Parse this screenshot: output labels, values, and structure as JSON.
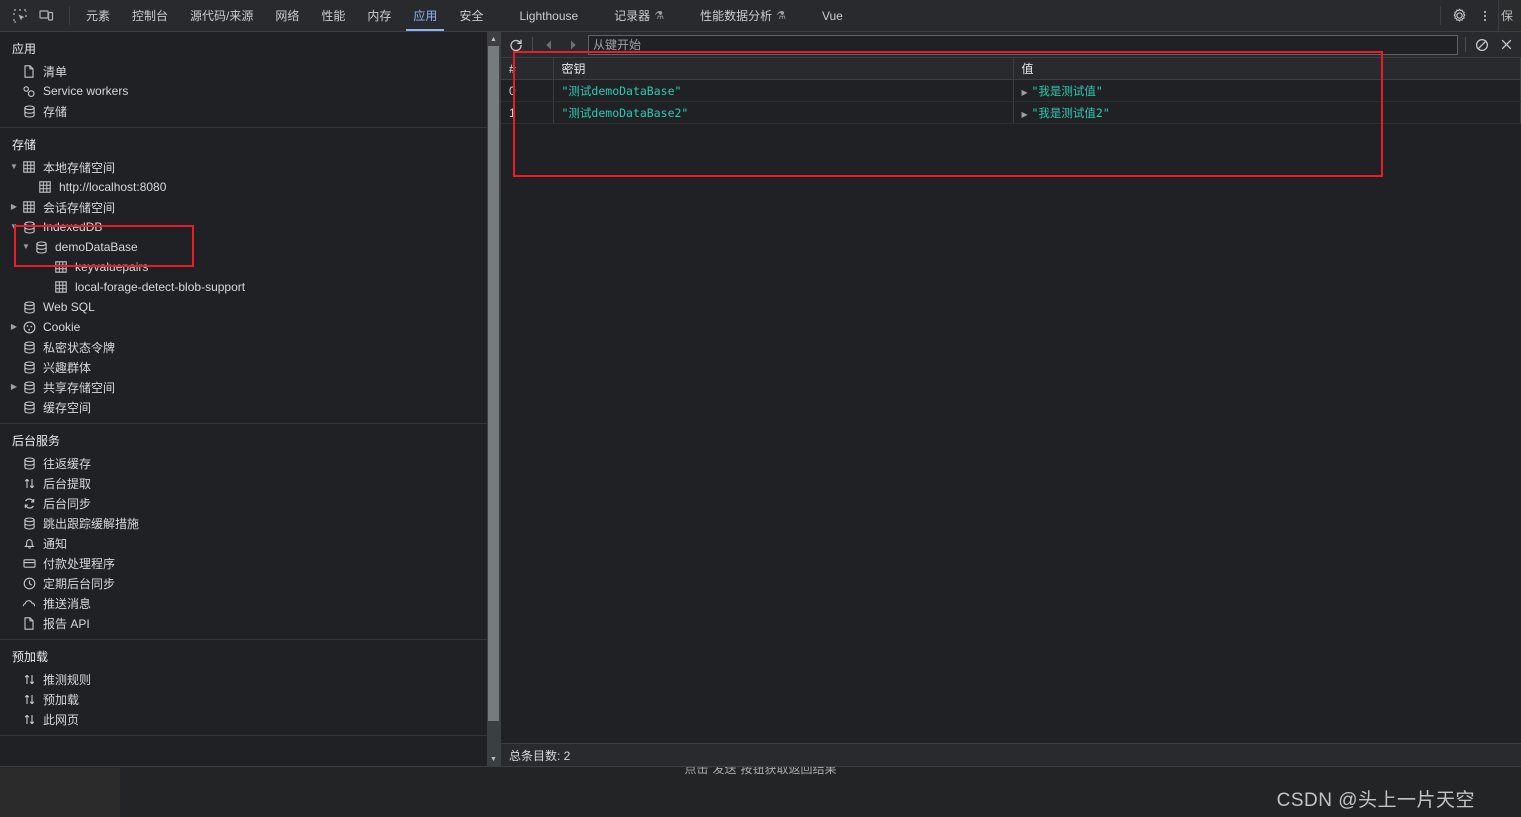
{
  "toolbar": {
    "inspect_icon": "inspect-element-icon",
    "device_icon": "device-toolbar-icon",
    "settings_icon": "gear-icon",
    "more_icon": "more-vertical-icon",
    "edge_label": "保"
  },
  "tabs": [
    {
      "label": "元素",
      "active": false,
      "flask": ""
    },
    {
      "label": "控制台",
      "active": false,
      "flask": ""
    },
    {
      "label": "源代码/来源",
      "active": false,
      "flask": ""
    },
    {
      "label": "网络",
      "active": false,
      "flask": ""
    },
    {
      "label": "性能",
      "active": false,
      "flask": ""
    },
    {
      "label": "内存",
      "active": false,
      "flask": ""
    },
    {
      "label": "应用",
      "active": true,
      "flask": ""
    },
    {
      "label": "安全",
      "active": false,
      "flask": ""
    },
    {
      "label": "Lighthouse",
      "active": false,
      "flask": ""
    },
    {
      "label": "记录器",
      "active": false,
      "flask": "⚗"
    },
    {
      "label": "性能数据分析",
      "active": false,
      "flask": "⚗"
    },
    {
      "label": "Vue",
      "active": false,
      "flask": ""
    }
  ],
  "sidebar": {
    "sections": [
      {
        "title": "应用",
        "items": [
          {
            "label": "清单",
            "icon": "manifest-document-icon",
            "indent": 1,
            "twisty": "none",
            "selected": false
          },
          {
            "label": "Service workers",
            "icon": "service-worker-gears-icon",
            "indent": 1,
            "twisty": "none",
            "selected": false
          },
          {
            "label": "存储",
            "icon": "database-icon",
            "indent": 1,
            "twisty": "none",
            "selected": false
          }
        ]
      },
      {
        "title": "存储",
        "items": [
          {
            "label": "本地存储空间",
            "icon": "table-icon",
            "indent": 1,
            "twisty": "open",
            "selected": false
          },
          {
            "label": "http://localhost:8080",
            "icon": "table-icon",
            "indent": 2,
            "twisty": "none",
            "selected": false
          },
          {
            "label": "会话存储空间",
            "icon": "table-icon",
            "indent": 1,
            "twisty": "closed",
            "selected": false
          },
          {
            "label": "IndexedDB",
            "icon": "database-icon",
            "indent": 1,
            "twisty": "open",
            "selected": false
          },
          {
            "label": "demoDataBase",
            "icon": "database-icon",
            "indent": 2,
            "twisty": "open",
            "selected": false
          },
          {
            "label": "keyvaluepairs",
            "icon": "table-icon",
            "indent": 3,
            "twisty": "none",
            "selected": true
          },
          {
            "label": "local-forage-detect-blob-support",
            "icon": "table-icon",
            "indent": 3,
            "twisty": "none",
            "selected": false
          },
          {
            "label": "Web SQL",
            "icon": "database-icon",
            "indent": 1,
            "twisty": "none",
            "selected": false
          },
          {
            "label": "Cookie",
            "icon": "cookie-icon",
            "indent": 1,
            "twisty": "closed",
            "selected": false
          },
          {
            "label": "私密状态令牌",
            "icon": "database-icon",
            "indent": 1,
            "twisty": "none",
            "selected": false
          },
          {
            "label": "兴趣群体",
            "icon": "database-icon",
            "indent": 1,
            "twisty": "none",
            "selected": false
          },
          {
            "label": "共享存储空间",
            "icon": "database-icon",
            "indent": 1,
            "twisty": "closed",
            "selected": false
          },
          {
            "label": "缓存空间",
            "icon": "database-icon",
            "indent": 1,
            "twisty": "none",
            "selected": false
          }
        ]
      },
      {
        "title": "后台服务",
        "items": [
          {
            "label": "往返缓存",
            "icon": "database-icon",
            "indent": 1,
            "twisty": "none",
            "selected": false
          },
          {
            "label": "后台提取",
            "icon": "arrows-updown-icon",
            "indent": 1,
            "twisty": "none",
            "selected": false
          },
          {
            "label": "后台同步",
            "icon": "sync-icon",
            "indent": 1,
            "twisty": "none",
            "selected": false
          },
          {
            "label": "跳出跟踪缓解措施",
            "icon": "database-icon",
            "indent": 1,
            "twisty": "none",
            "selected": false
          },
          {
            "label": "通知",
            "icon": "bell-icon",
            "indent": 1,
            "twisty": "none",
            "selected": false
          },
          {
            "label": "付款处理程序",
            "icon": "credit-card-icon",
            "indent": 1,
            "twisty": "none",
            "selected": false
          },
          {
            "label": "定期后台同步",
            "icon": "clock-icon",
            "indent": 1,
            "twisty": "none",
            "selected": false
          },
          {
            "label": "推送消息",
            "icon": "cloud-icon",
            "indent": 1,
            "twisty": "none",
            "selected": false
          },
          {
            "label": "报告 API",
            "icon": "document-icon",
            "indent": 1,
            "twisty": "none",
            "selected": false
          }
        ]
      },
      {
        "title": "预加载",
        "items": [
          {
            "label": "推测规则",
            "icon": "arrows-updown-icon",
            "indent": 1,
            "twisty": "none",
            "selected": false
          },
          {
            "label": "预加载",
            "icon": "arrows-updown-icon",
            "indent": 1,
            "twisty": "none",
            "selected": false
          },
          {
            "label": "此网页",
            "icon": "arrows-updown-icon",
            "indent": 1,
            "twisty": "none",
            "selected": false
          }
        ]
      }
    ]
  },
  "main_toolbar": {
    "refresh_icon": "refresh-icon",
    "prev_icon": "arrow-left-icon",
    "next_icon": "arrow-right-icon",
    "filter_placeholder": "从键开始",
    "filter_value": "",
    "clear_icon": "clear-circle-slash-icon",
    "delete_icon": "close-x-icon"
  },
  "grid": {
    "columns": [
      "#",
      "密钥",
      "值"
    ],
    "rows": [
      {
        "index": "0",
        "key": "\"测试demoDataBase\"",
        "value": "\"我是测试值\""
      },
      {
        "index": "1",
        "key": "\"测试demoDataBase2\"",
        "value": "\"我是测试值2\""
      }
    ]
  },
  "statusbar": {
    "total_label": "总条目数: 2"
  },
  "page": {
    "hint": "点击“发送”按钮获取返回结果",
    "watermark": "CSDN @头上一片天空"
  },
  "colors": {
    "accent_tab": "#8ab4f8",
    "string_value": "#2ec9b0",
    "annotation_red": "#ec1c24",
    "panel_bg": "#202124",
    "toolbar_bg": "#292a2d"
  }
}
